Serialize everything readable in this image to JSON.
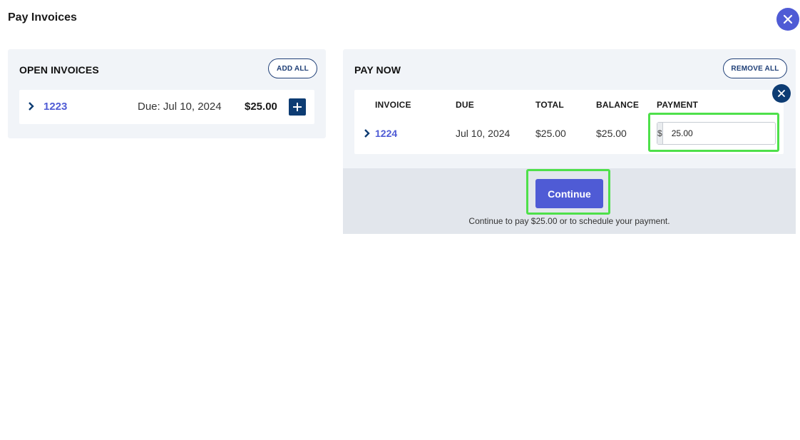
{
  "modal": {
    "title": "Pay Invoices",
    "close_icon": "close-icon",
    "accent_color": "#4f5bd5"
  },
  "open_invoices": {
    "heading": "OPEN INVOICES",
    "add_all_label": "ADD ALL",
    "items": [
      {
        "number": "1223",
        "due": "Due: Jul 10, 2024",
        "amount": "$25.00",
        "add_icon": "plus-icon"
      }
    ]
  },
  "pay_now": {
    "heading": "PAY NOW",
    "remove_all_label": "REMOVE ALL",
    "columns": [
      "INVOICE",
      "DUE",
      "TOTAL",
      "BALANCE",
      "PAYMENT"
    ],
    "rows": [
      {
        "invoice": "1224",
        "due": "Jul 10, 2024",
        "total": "$25.00",
        "balance": "$25.00",
        "currency": "$",
        "payment": "25.00"
      }
    ],
    "continue_label": "Continue",
    "footer_note": "Continue to pay $25.00 or to schedule your payment."
  }
}
